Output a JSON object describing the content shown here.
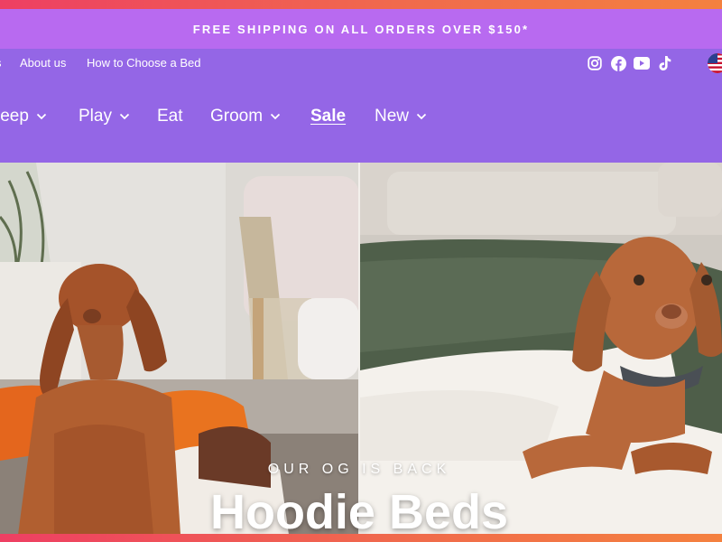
{
  "announcement": {
    "text": "FREE SHIPPING ON ALL ORDERS OVER $150*"
  },
  "utility_nav": {
    "items": [
      {
        "label": "s"
      },
      {
        "label": "About us"
      },
      {
        "label": "How to Choose a Bed"
      }
    ],
    "social_icons": [
      "instagram-icon",
      "facebook-icon",
      "youtube-icon",
      "tiktok-icon"
    ],
    "country_flag": "us-flag-icon"
  },
  "main_nav": {
    "items": [
      {
        "label": "leep",
        "has_dropdown": true
      },
      {
        "label": "Play",
        "has_dropdown": true
      },
      {
        "label": "Eat",
        "has_dropdown": false
      },
      {
        "label": "Groom",
        "has_dropdown": true
      },
      {
        "label": "Sale",
        "has_dropdown": false
      },
      {
        "label": "New",
        "has_dropdown": true
      }
    ]
  },
  "hero": {
    "eyebrow": "OUR OG IS BACK",
    "headline": "Hoodie Beds"
  },
  "colors": {
    "announcement_bg": "#b86af0",
    "header_bg": "#9466e6",
    "frame_gradient_start": "#ee3f63",
    "frame_gradient_end": "#f4813f"
  }
}
